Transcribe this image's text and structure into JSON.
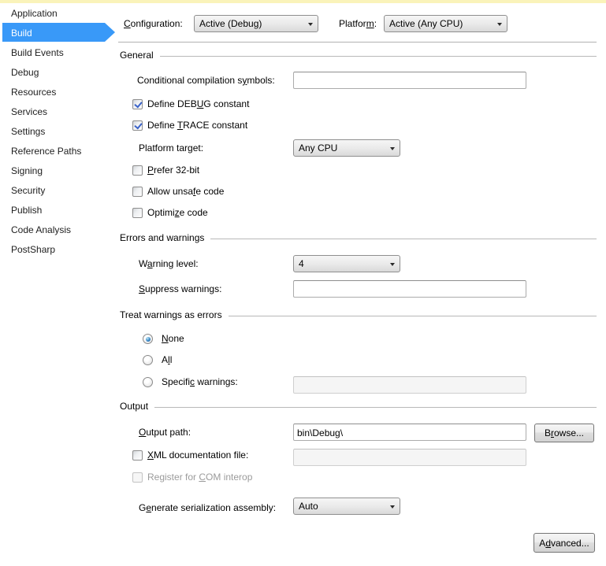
{
  "colors": {
    "selection_blue": "#3999f8",
    "top_strip_yellow": "#faf3ba",
    "check_blue": "#3a62c8"
  },
  "sidebar": {
    "items": [
      {
        "label": "Application",
        "selected": false
      },
      {
        "label": "Build",
        "selected": true
      },
      {
        "label": "Build Events",
        "selected": false
      },
      {
        "label": "Debug",
        "selected": false
      },
      {
        "label": "Resources",
        "selected": false
      },
      {
        "label": "Services",
        "selected": false
      },
      {
        "label": "Settings",
        "selected": false
      },
      {
        "label": "Reference Paths",
        "selected": false
      },
      {
        "label": "Signing",
        "selected": false
      },
      {
        "label": "Security",
        "selected": false
      },
      {
        "label": "Publish",
        "selected": false
      },
      {
        "label": "Code Analysis",
        "selected": false
      },
      {
        "label": "PostSharp",
        "selected": false
      }
    ]
  },
  "topbar": {
    "configuration_label": {
      "text": "Configuration:",
      "mn": 0
    },
    "configuration_value": "Active (Debug)",
    "platform_label": {
      "text": "Platform:",
      "mn": 7
    },
    "platform_value": "Active (Any CPU)"
  },
  "general": {
    "title": "General",
    "conditional_label": {
      "text": "Conditional compilation symbols:",
      "mn": 25
    },
    "conditional_value": "",
    "define_debug": {
      "text": "Define DEBUG constant",
      "mn": 10,
      "checked": true
    },
    "define_trace": {
      "text": "Define TRACE constant",
      "mn": 7,
      "checked": true
    },
    "platform_target_label": {
      "text": "Platform target:",
      "mn": -1
    },
    "platform_target_value": "Any CPU",
    "prefer_32bit": {
      "text": "Prefer 32-bit",
      "mn": 0,
      "checked": false
    },
    "allow_unsafe": {
      "text": "Allow unsafe code",
      "mn": 10,
      "checked": false
    },
    "optimize": {
      "text": "Optimize code",
      "mn": 6,
      "checked": false
    }
  },
  "errors_warnings": {
    "title": "Errors and warnings",
    "warning_level_label": {
      "text": "Warning level:",
      "mn": 1
    },
    "warning_level_value": "4",
    "suppress_label": {
      "text": "Suppress warnings:",
      "mn": 0
    },
    "suppress_value": ""
  },
  "treat_warnings": {
    "title": "Treat warnings as errors",
    "none": {
      "text": "None",
      "mn": 0,
      "selected": true
    },
    "all": {
      "text": "All",
      "mn": 1,
      "selected": false
    },
    "specific": {
      "text": "Specific warnings:",
      "mn": 7,
      "selected": false
    },
    "specific_value": ""
  },
  "output": {
    "title": "Output",
    "output_path_label": {
      "text": "Output path:",
      "mn": 0
    },
    "output_path_value": "bin\\Debug\\",
    "browse_button": {
      "text": "Browse...",
      "mn": 1
    },
    "xml_doc": {
      "text": "XML documentation file:",
      "mn": 0,
      "checked": false
    },
    "xml_doc_value": "",
    "com_interop": {
      "text": "Register for COM interop",
      "mn": 13,
      "checked": false,
      "disabled": true
    },
    "serialization_label": {
      "text": "Generate serialization assembly:",
      "mn": 1
    },
    "serialization_value": "Auto"
  },
  "advanced_button": {
    "text": "Advanced...",
    "mn": 1
  }
}
